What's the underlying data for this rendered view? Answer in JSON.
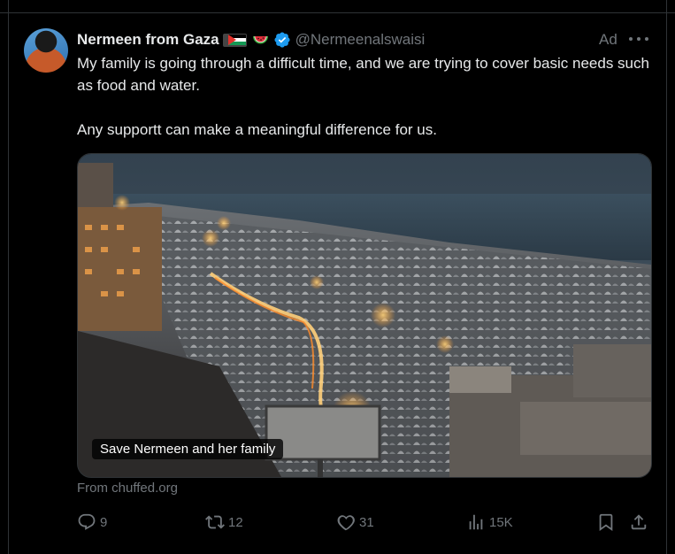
{
  "tweet": {
    "author_name": "Nermeen from Gaza",
    "handle": "@Nermeenalswaisi",
    "ad_label": "Ad",
    "text_line1": "My family is going through a difficult time, and we are trying to cover basic needs such as food and water.",
    "text_line2": "Any supportt can make a meaningful difference for us.",
    "media_caption": "Save Nermeen and her family",
    "source": "From chuffed.org"
  },
  "actions": {
    "replies": "9",
    "reposts": "12",
    "likes": "31",
    "views": "15K"
  },
  "colors": {
    "background": "#000000",
    "text": "#e7e9ea",
    "muted": "#71767b",
    "verified": "#1d9bf0",
    "border": "#2f3336"
  },
  "icons": [
    "reply-icon",
    "repost-icon",
    "like-icon",
    "views-icon",
    "bookmark-icon",
    "share-icon",
    "more-icon",
    "verified-badge-icon",
    "palestine-flag-icon",
    "watermelon-icon"
  ]
}
